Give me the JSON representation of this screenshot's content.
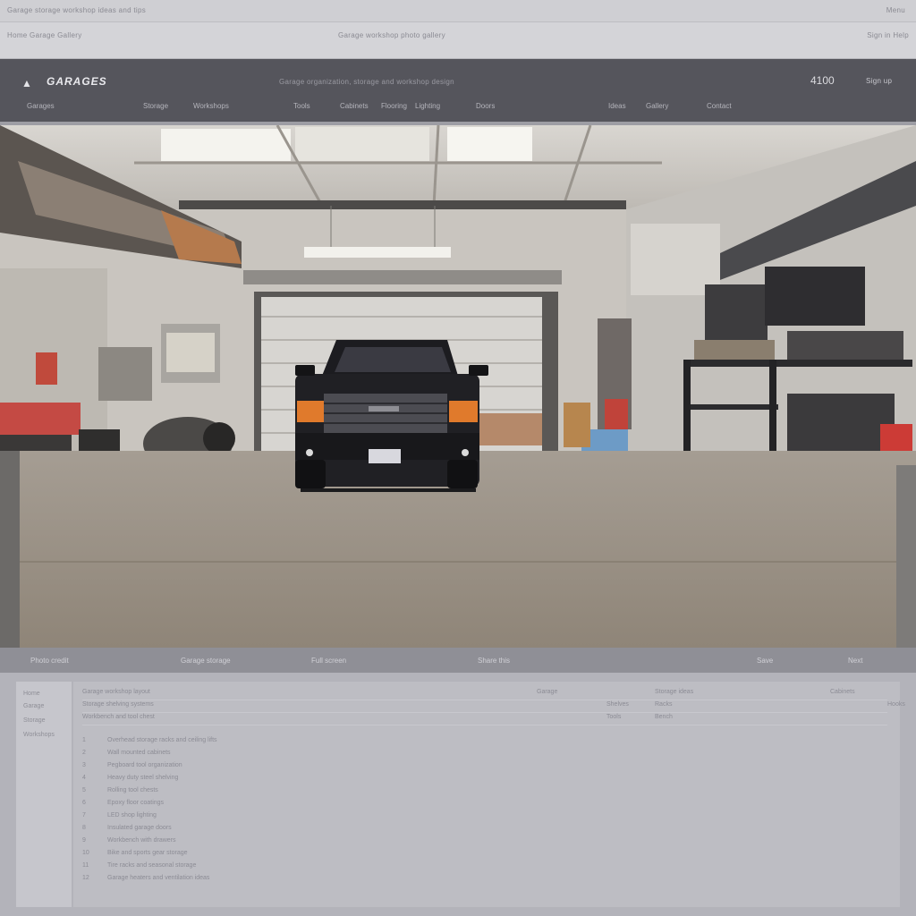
{
  "browser": {
    "tab_title": "Garage storage workshop ideas and tips",
    "tab_right": "Menu",
    "address_left": "Home  Garage  Gallery",
    "address_mid": "Garage workshop photo gallery",
    "address_right": "Sign in  Help"
  },
  "site": {
    "logo_text": "GARAGES",
    "tagline": "Garage organization, storage and workshop design",
    "number": "4100",
    "sign_label": "Sign up",
    "nav": [
      "Garages",
      "Storage",
      "Workshops",
      "Tools",
      "Cabinets",
      "Flooring",
      "Lighting",
      "Doors",
      "Ideas",
      "Gallery",
      "Contact"
    ]
  },
  "hero": {
    "image_label": "garage-interior-with-black-pickup-truck",
    "accent": "#e07a2c"
  },
  "caption": {
    "items": [
      "Photo credit",
      "Garage storage",
      "Full screen",
      "Share this",
      "Save",
      "Next"
    ]
  },
  "sidebar": {
    "items": [
      "Home",
      "Garage",
      "Storage",
      "Workshops"
    ]
  },
  "content": {
    "rows": [
      [
        "Garage workshop layout",
        "Garage",
        "Storage ideas",
        "Cabinets"
      ],
      [
        "Storage shelving systems",
        "Shelves",
        "Racks",
        "Hooks"
      ],
      [
        "Workbench and tool chest",
        "Tools",
        "Bench"
      ]
    ],
    "list_numbers": [
      "1",
      "2",
      "3",
      "4",
      "5",
      "6",
      "7",
      "8",
      "9",
      "10",
      "11",
      "12"
    ],
    "list": [
      "Overhead storage racks and ceiling lifts",
      "Wall mounted cabinets",
      "Pegboard tool organization",
      "Heavy duty steel shelving",
      "Rolling tool chests",
      "Epoxy floor coatings",
      "LED shop lighting",
      "Insulated garage doors",
      "Workbench with drawers",
      "Bike and sports gear storage",
      "Tire racks and seasonal storage",
      "Garage heaters and ventilation ideas"
    ]
  }
}
